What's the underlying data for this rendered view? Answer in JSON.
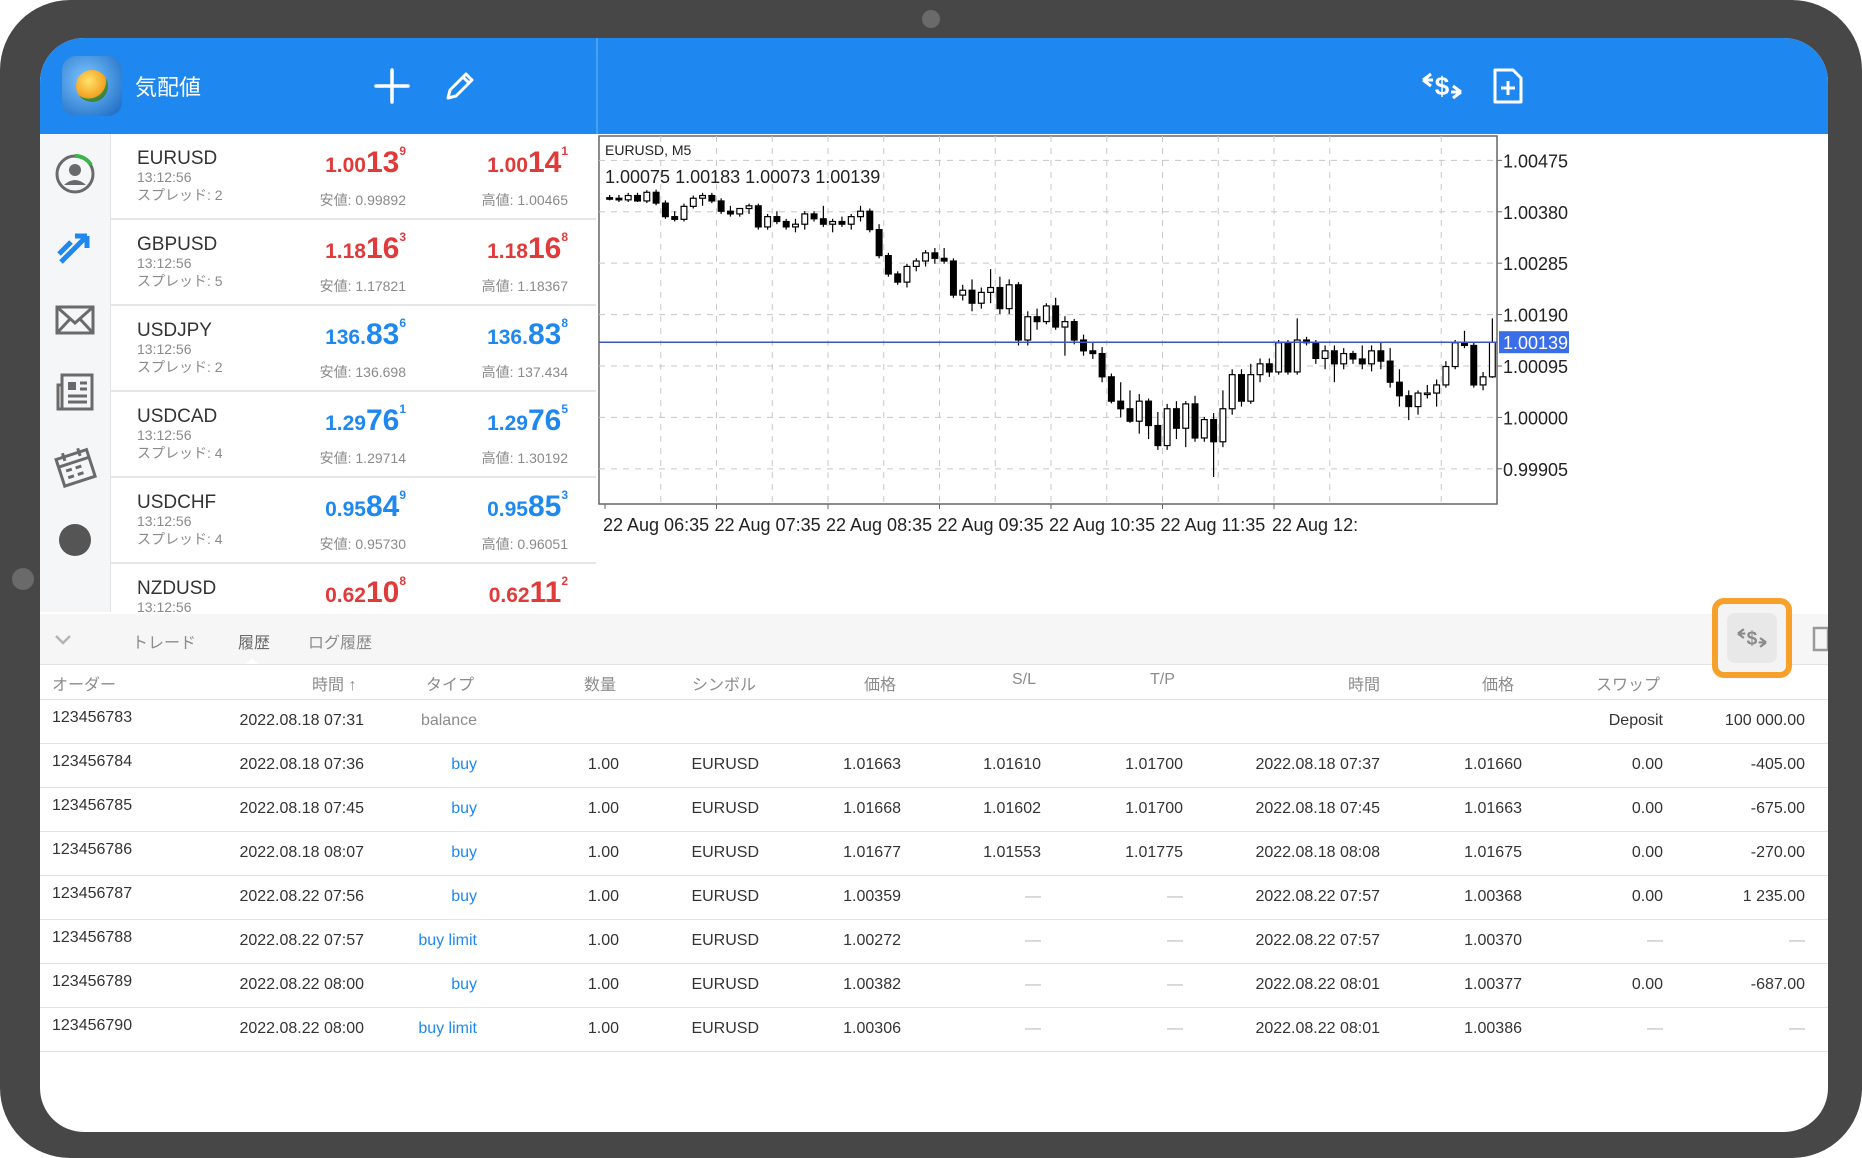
{
  "header": {
    "title": "気配値"
  },
  "quotes": [
    {
      "symbol": "EURUSD",
      "time": "13:12:56",
      "spread": "スプレッド: 2",
      "color": "red",
      "bid": {
        "pre": "1.00",
        "big": "13",
        "sup": "9"
      },
      "ask": {
        "pre": "1.00",
        "big": "14",
        "sup": "1"
      },
      "low": "安値: 0.99892",
      "high": "高値: 1.00465"
    },
    {
      "symbol": "GBPUSD",
      "time": "13:12:56",
      "spread": "スプレッド: 5",
      "color": "red",
      "bid": {
        "pre": "1.18",
        "big": "16",
        "sup": "3"
      },
      "ask": {
        "pre": "1.18",
        "big": "16",
        "sup": "8"
      },
      "low": "安値: 1.17821",
      "high": "高値: 1.18367"
    },
    {
      "symbol": "USDJPY",
      "time": "13:12:56",
      "spread": "スプレッド: 2",
      "color": "blue",
      "bid": {
        "pre": "136.",
        "big": "83",
        "sup": "6"
      },
      "ask": {
        "pre": "136.",
        "big": "83",
        "sup": "8"
      },
      "low": "安値: 136.698",
      "high": "高値: 137.434"
    },
    {
      "symbol": "USDCAD",
      "time": "13:12:56",
      "spread": "スプレッド: 4",
      "color": "blue",
      "bid": {
        "pre": "1.29",
        "big": "76",
        "sup": "1"
      },
      "ask": {
        "pre": "1.29",
        "big": "76",
        "sup": "5"
      },
      "low": "安値: 1.29714",
      "high": "高値: 1.30192"
    },
    {
      "symbol": "USDCHF",
      "time": "13:12:56",
      "spread": "スプレッド: 4",
      "color": "blue",
      "bid": {
        "pre": "0.95",
        "big": "84",
        "sup": "9"
      },
      "ask": {
        "pre": "0.95",
        "big": "85",
        "sup": "3"
      },
      "low": "安値: 0.95730",
      "high": "高値: 0.96051"
    },
    {
      "symbol": "NZDUSD",
      "time": "13:12:56",
      "spread": "",
      "color": "red",
      "bid": {
        "pre": "0.62",
        "big": "10",
        "sup": "8"
      },
      "ask": {
        "pre": "0.62",
        "big": "11",
        "sup": "2"
      },
      "low": "",
      "high": ""
    }
  ],
  "chart": {
    "symbol_tf": "EURUSD, M5",
    "ohlc": "1.00075 1.00183 1.00073 1.00139",
    "current_price": "1.00139",
    "colors": {
      "line": "#3a55c8",
      "price_box": "#3a6ee8"
    }
  },
  "chart_data": {
    "type": "candlestick",
    "x_tick_labels": [
      "22 Aug 06:35",
      "22 Aug 07:35",
      "22 Aug 08:35",
      "22 Aug 09:35",
      "22 Aug 10:35",
      "22 Aug 11:35",
      "22 Aug 12:"
    ],
    "y_tick_labels": [
      "1.00475",
      "1.00380",
      "1.00285",
      "1.00190",
      "1.00095",
      "1.00000",
      "0.99905"
    ],
    "ylim": [
      0.9984,
      1.0052
    ],
    "current_price": 1.00139,
    "candles": [
      [
        1.00406,
        1.00411,
        1.00401,
        1.00405
      ],
      [
        1.00405,
        1.00411,
        1.00398,
        1.00402
      ],
      [
        1.00402,
        1.00415,
        1.00398,
        1.0041
      ],
      [
        1.0041,
        1.00415,
        1.00398,
        1.004
      ],
      [
        1.004,
        1.0042,
        1.00396,
        1.00416
      ],
      [
        1.00416,
        1.00421,
        1.00392,
        1.00396
      ],
      [
        1.00396,
        1.00401,
        1.00367,
        1.00371
      ],
      [
        1.00371,
        1.00381,
        1.00362,
        1.00366
      ],
      [
        1.00366,
        1.00395,
        1.00362,
        1.0039
      ],
      [
        1.0039,
        1.0041,
        1.00386,
        1.00405
      ],
      [
        1.00405,
        1.00415,
        1.00391,
        1.0041
      ],
      [
        1.0041,
        1.00415,
        1.00396,
        1.004
      ],
      [
        1.004,
        1.00405,
        1.00376,
        1.00381
      ],
      [
        1.00381,
        1.00391,
        1.00371,
        1.00376
      ],
      [
        1.00376,
        1.00386,
        1.00371,
        1.00386
      ],
      [
        1.00386,
        1.00395,
        1.00376,
        1.00391
      ],
      [
        1.00391,
        1.00395,
        1.00347,
        1.00352
      ],
      [
        1.00352,
        1.00376,
        1.00347,
        1.00371
      ],
      [
        1.00371,
        1.00381,
        1.00357,
        1.00362
      ],
      [
        1.00362,
        1.00367,
        1.00347,
        1.00352
      ],
      [
        1.00352,
        1.00367,
        1.00342,
        1.00357
      ],
      [
        1.00357,
        1.00381,
        1.00347,
        1.00376
      ],
      [
        1.00376,
        1.00381,
        1.00362,
        1.00367
      ],
      [
        1.00367,
        1.00391,
        1.00352,
        1.00357
      ],
      [
        1.00357,
        1.00367,
        1.00342,
        1.00362
      ],
      [
        1.00362,
        1.00371,
        1.00352,
        1.00357
      ],
      [
        1.00357,
        1.00376,
        1.00347,
        1.00371
      ],
      [
        1.00371,
        1.00391,
        1.00362,
        1.00381
      ],
      [
        1.00381,
        1.00386,
        1.00342,
        1.00347
      ],
      [
        1.00347,
        1.00357,
        1.00294,
        1.00299
      ],
      [
        1.00299,
        1.00304,
        1.0026,
        1.00265
      ],
      [
        1.00265,
        1.0027,
        1.00245,
        1.0025
      ],
      [
        1.0025,
        1.00284,
        1.0024,
        1.00279
      ],
      [
        1.00279,
        1.00294,
        1.0027,
        1.00289
      ],
      [
        1.00289,
        1.00309,
        1.00279,
        1.00304
      ],
      [
        1.00304,
        1.00313,
        1.00284,
        1.00294
      ],
      [
        1.00294,
        1.00313,
        1.00284,
        1.00289
      ],
      [
        1.00289,
        1.00294,
        1.00221,
        1.00226
      ],
      [
        1.00226,
        1.00245,
        1.00216,
        1.00235
      ],
      [
        1.00235,
        1.00255,
        1.00196,
        1.00211
      ],
      [
        1.00211,
        1.0024,
        1.00201,
        1.00231
      ],
      [
        1.00231,
        1.00274,
        1.00211,
        1.0024
      ],
      [
        1.0024,
        1.0026,
        1.00191,
        1.00201
      ],
      [
        1.00201,
        1.00255,
        1.00191,
        1.00245
      ],
      [
        1.00245,
        1.0025,
        1.00133,
        1.00143
      ],
      [
        1.00143,
        1.00196,
        1.00133,
        1.00186
      ],
      [
        1.00186,
        1.00201,
        1.00162,
        1.00177
      ],
      [
        1.00177,
        1.00211,
        1.00172,
        1.00206
      ],
      [
        1.00206,
        1.00221,
        1.00162,
        1.00167
      ],
      [
        1.00167,
        1.00187,
        1.00114,
        1.00177
      ],
      [
        1.00177,
        1.00182,
        1.00135,
        1.00143
      ],
      [
        1.00143,
        1.00153,
        1.00114,
        1.00123
      ],
      [
        1.00123,
        1.00138,
        1.00108,
        1.00118
      ],
      [
        1.00118,
        1.0013,
        1.00065,
        1.00075
      ],
      [
        1.00075,
        1.00081,
        1.00026,
        1.0003
      ],
      [
        1.0003,
        1.00065,
        1.0,
        1.00016
      ],
      [
        1.00016,
        1.0005,
        0.9999,
        0.99993
      ],
      [
        0.99993,
        1.00043,
        0.9997,
        1.0003
      ],
      [
        1.0003,
        1.00035,
        0.9996,
        0.99985
      ],
      [
        0.99985,
        1.0001,
        0.9994,
        0.99948
      ],
      [
        0.99948,
        1.00025,
        0.9994,
        1.00016
      ],
      [
        1.00016,
        1.0003,
        0.9996,
        0.9998
      ],
      [
        0.9998,
        1.0003,
        0.99945,
        1.00025
      ],
      [
        1.00025,
        1.0004,
        0.99955,
        0.99962
      ],
      [
        0.99962,
        1.00001,
        0.99955,
        0.99996
      ],
      [
        0.99996,
        1.00008,
        0.9989,
        0.99955
      ],
      [
        0.99955,
        1.0005,
        0.99945,
        1.00016
      ],
      [
        1.00016,
        1.00089,
        1.00005,
        1.00079
      ],
      [
        1.00079,
        1.00089,
        1.0002,
        1.0003
      ],
      [
        1.0003,
        1.00099,
        1.00025,
        1.00079
      ],
      [
        1.00079,
        1.00109,
        1.00065,
        1.00099
      ],
      [
        1.00099,
        1.00109,
        1.00075,
        1.00084
      ],
      [
        1.00084,
        1.00143,
        1.00079,
        1.00138
      ],
      [
        1.00138,
        1.00143,
        1.00079,
        1.00084
      ],
      [
        1.00084,
        1.00183,
        1.00079,
        1.00143
      ],
      [
        1.00143,
        1.00149,
        1.00133,
        1.00138
      ],
      [
        1.00138,
        1.00143,
        1.00099,
        1.00109
      ],
      [
        1.00109,
        1.00133,
        1.00089,
        1.00123
      ],
      [
        1.00123,
        1.00133,
        1.00065,
        1.00099
      ],
      [
        1.00099,
        1.00128,
        1.00089,
        1.00118
      ],
      [
        1.00118,
        1.00123,
        1.00099,
        1.00108
      ],
      [
        1.00108,
        1.00133,
        1.00089,
        1.00099
      ],
      [
        1.00099,
        1.00133,
        1.00085,
        1.00123
      ],
      [
        1.00123,
        1.00138,
        1.00089,
        1.00104
      ],
      [
        1.00104,
        1.00128,
        1.00055,
        1.00065
      ],
      [
        1.00065,
        1.00089,
        1.0002,
        1.0004
      ],
      [
        1.0004,
        1.0005,
        0.99995,
        1.0002
      ],
      [
        1.0002,
        1.0005,
        1.00005,
        1.00045
      ],
      [
        1.00045,
        1.0006,
        1.00035,
        1.00045
      ],
      [
        1.00045,
        1.0007,
        1.0002,
        1.0006
      ],
      [
        1.0006,
        1.00104,
        1.00055,
        1.00094
      ],
      [
        1.00094,
        1.00143,
        1.00089,
        1.00138
      ],
      [
        1.00138,
        1.0016,
        1.00128,
        1.00133
      ],
      [
        1.00133,
        1.00138,
        1.00055,
        1.0006
      ],
      [
        1.0006,
        1.00084,
        1.0005,
        1.00075
      ],
      [
        1.00075,
        1.00183,
        1.00073,
        1.00139
      ]
    ]
  },
  "tabs": {
    "trade": "トレード",
    "history": "履歴",
    "log_history": "ログ履歴"
  },
  "columns": {
    "order": "オーダー",
    "time_open": "時間 ↑",
    "type": "タイプ",
    "volume": "数量",
    "symbol": "シンボル",
    "price_open": "価格",
    "sl": "S/L",
    "tp": "T/P",
    "time_close": "時間",
    "price_close": "価格",
    "swap": "スワップ"
  },
  "rows": [
    {
      "order": "123456783",
      "time": "2022.08.18 07:31",
      "type": "balance",
      "volume": "",
      "symbol": "",
      "price": "",
      "sl": "",
      "tp": "",
      "time2": "",
      "price2": "",
      "swap": "Deposit",
      "profit": "100 000.00"
    },
    {
      "order": "123456784",
      "time": "2022.08.18 07:36",
      "type": "buy",
      "volume": "1.00",
      "symbol": "EURUSD",
      "price": "1.01663",
      "sl": "1.01610",
      "tp": "1.01700",
      "time2": "2022.08.18 07:37",
      "price2": "1.01660",
      "swap": "0.00",
      "profit": "-405.00"
    },
    {
      "order": "123456785",
      "time": "2022.08.18 07:45",
      "type": "buy",
      "volume": "1.00",
      "symbol": "EURUSD",
      "price": "1.01668",
      "sl": "1.01602",
      "tp": "1.01700",
      "time2": "2022.08.18 07:45",
      "price2": "1.01663",
      "swap": "0.00",
      "profit": "-675.00"
    },
    {
      "order": "123456786",
      "time": "2022.08.18 08:07",
      "type": "buy",
      "volume": "1.00",
      "symbol": "EURUSD",
      "price": "1.01677",
      "sl": "1.01553",
      "tp": "1.01775",
      "time2": "2022.08.18 08:08",
      "price2": "1.01675",
      "swap": "0.00",
      "profit": "-270.00"
    },
    {
      "order": "123456787",
      "time": "2022.08.22 07:56",
      "type": "buy",
      "volume": "1.00",
      "symbol": "EURUSD",
      "price": "1.00359",
      "sl": "—",
      "tp": "—",
      "time2": "2022.08.22 07:57",
      "price2": "1.00368",
      "swap": "0.00",
      "profit": "1 235.00"
    },
    {
      "order": "123456788",
      "time": "2022.08.22 07:57",
      "type": "buy limit",
      "volume": "1.00",
      "symbol": "EURUSD",
      "price": "1.00272",
      "sl": "—",
      "tp": "—",
      "time2": "2022.08.22 07:57",
      "price2": "1.00370",
      "swap": "—",
      "profit": "—"
    },
    {
      "order": "123456789",
      "time": "2022.08.22 08:00",
      "type": "buy",
      "volume": "1.00",
      "symbol": "EURUSD",
      "price": "1.00382",
      "sl": "—",
      "tp": "—",
      "time2": "2022.08.22 08:01",
      "price2": "1.00377",
      "swap": "0.00",
      "profit": "-687.00"
    },
    {
      "order": "123456790",
      "time": "2022.08.22 08:00",
      "type": "buy limit",
      "volume": "1.00",
      "symbol": "EURUSD",
      "price": "1.00306",
      "sl": "—",
      "tp": "—",
      "time2": "2022.08.22 08:01",
      "price2": "1.00386",
      "swap": "—",
      "profit": "—"
    }
  ],
  "colors": {
    "accent": "#1e88f0",
    "highlight": "#f7a02a",
    "sell_red": "#e03a3a",
    "buy_blue": "#1e88f0"
  },
  "icons": [
    "plus-icon",
    "pencil-icon",
    "currency-exchange-icon",
    "new-order-icon",
    "account-icon",
    "trade-arrows-icon",
    "mail-icon",
    "news-icon",
    "calendar-icon",
    "chevron-down-icon"
  ]
}
